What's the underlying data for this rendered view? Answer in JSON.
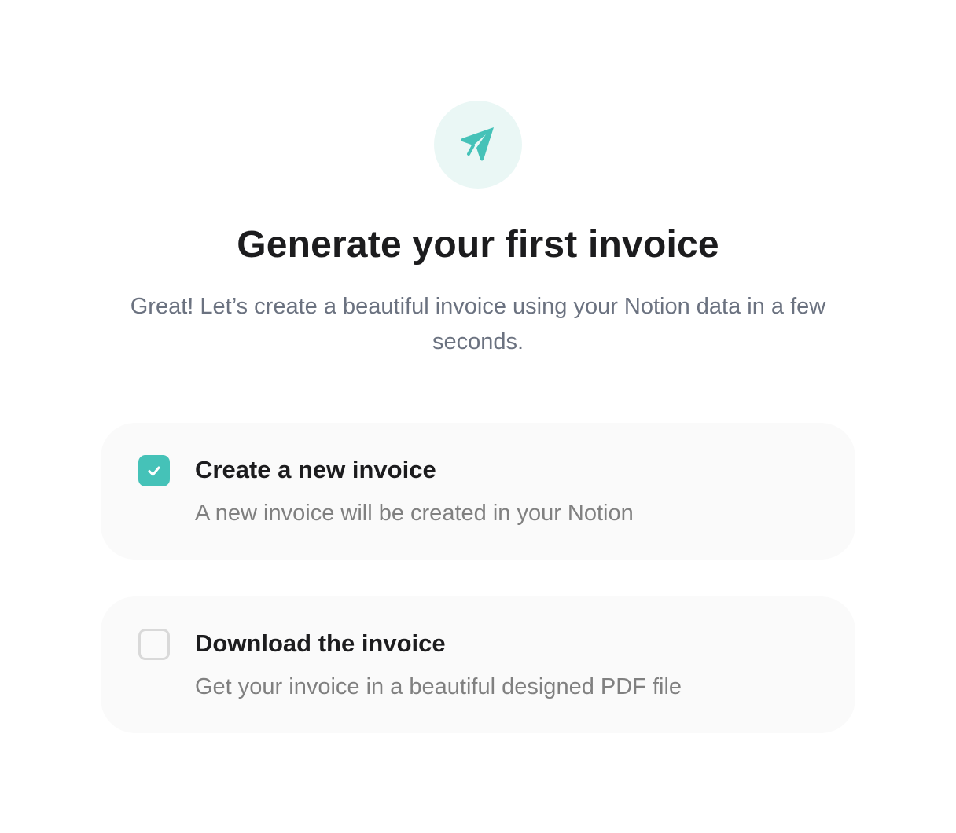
{
  "hero": {
    "icon": "paper-plane-icon",
    "accent_color": "#45c2b8",
    "badge_background": "#eaf7f5"
  },
  "title": "Generate your first invoice",
  "subtitle": "Great! Let’s create a beautiful invoice using your Notion data in a few seconds.",
  "options": [
    {
      "title": "Create a new invoice",
      "description": "A new invoice will be created in your Notion",
      "checked": true,
      "icon": "checkmark-icon"
    },
    {
      "title": "Download the invoice",
      "description": "Get your invoice in a beautiful designed PDF file",
      "checked": false
    }
  ],
  "colors": {
    "checkbox_checked": "#45c2b8",
    "checkbox_unchecked_border": "#d9d9d9",
    "card_background": "#fafafa",
    "title_text": "#1c1c1e",
    "subtitle_text": "#6b7280"
  }
}
